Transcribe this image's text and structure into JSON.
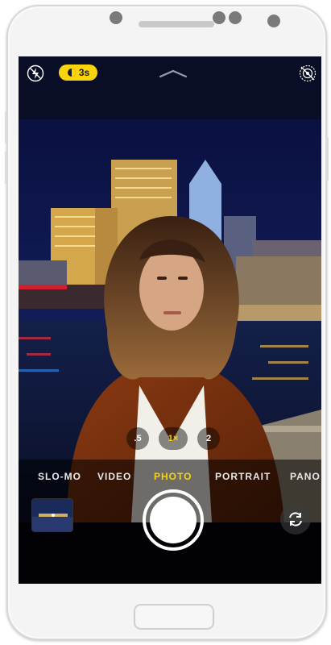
{
  "camera": {
    "flash_icon": "flash-off-icon",
    "live_photo_timer": "3s",
    "chevron_icon": "chevron-up-icon",
    "live_icon": "live-photo-off-icon",
    "zoom_levels": [
      {
        "label": ".5",
        "active": false
      },
      {
        "label": "1×",
        "active": true
      },
      {
        "label": "2",
        "active": false
      }
    ],
    "modes": [
      {
        "label": "SLO-MO",
        "active": false
      },
      {
        "label": "VIDEO",
        "active": false
      },
      {
        "label": "PHOTO",
        "active": true
      },
      {
        "label": "PORTRAIT",
        "active": false
      },
      {
        "label": "PANO",
        "active": false
      }
    ],
    "accent_color": "#f9d30c"
  }
}
